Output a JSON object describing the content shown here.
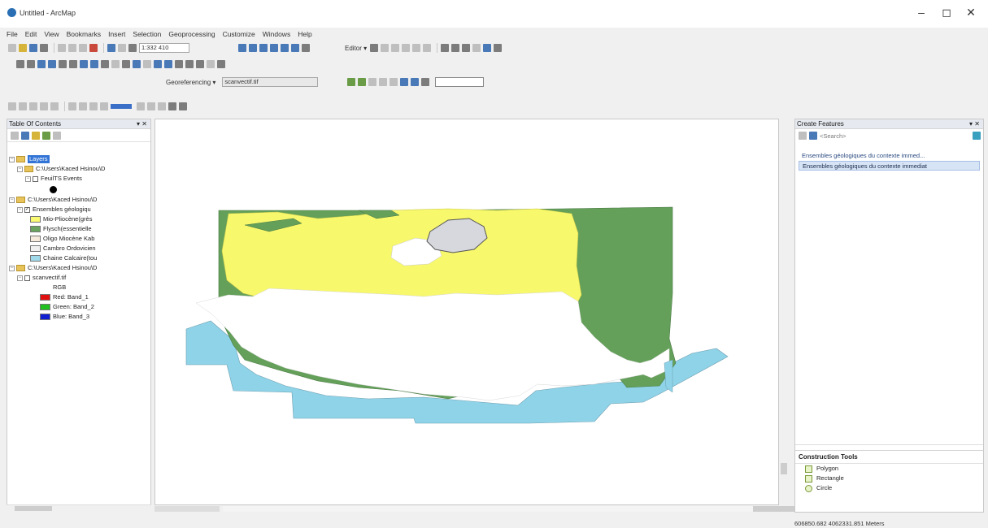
{
  "window": {
    "title": "Untitled - ArcMap",
    "controls": {
      "minimize": "–",
      "maximize": "◻",
      "close": "✕"
    }
  },
  "menu": [
    "File",
    "Edit",
    "View",
    "Bookmarks",
    "Insert",
    "Selection",
    "Geoprocessing",
    "Customize",
    "Windows",
    "Help"
  ],
  "toolbar": {
    "scale": "1:332 410",
    "editor": "Editor ▾",
    "georeferencing": "Georeferencing ▾",
    "georef_layer": "scanvectif.tif"
  },
  "toc": {
    "title": "Table Of Contents",
    "pin": "▾ ✕",
    "layers_label": "Layers",
    "group1_path": "C:\\Users\\Kaced Hsinou\\D",
    "feature_layer": "FeuilTS Events",
    "group2_path": "C:\\Users\\Kaced Hsinou\\D",
    "geo_layer": "Ensembles géologiqu",
    "legend": [
      {
        "label": "Mio-Pliocène(grès",
        "color": "#fafa73"
      },
      {
        "label": "Flysch(essentielle",
        "color": "#69a35f"
      },
      {
        "label": "Oligo Miocène Kab",
        "color": "#f6eadc"
      },
      {
        "label": "Cambro Ordovicien",
        "color": "#f0f0f0"
      },
      {
        "label": "Chaine Calcaire(tou",
        "color": "#9fd9ea"
      }
    ],
    "group3_path": "C:\\Users\\Kaced Hsinou\\D",
    "raster_layer": "scanvectif.tif",
    "rgb_label": "RGB",
    "bands": [
      {
        "label": "Red:   Band_1",
        "color": "#e01010"
      },
      {
        "label": "Green: Band_2",
        "color": "#20c020"
      },
      {
        "label": "Blue:  Band_3",
        "color": "#1020d0"
      }
    ]
  },
  "map": {
    "colors": {
      "mio_pliocene": "#f8f86c",
      "flysch": "#64a05a",
      "calcaire": "#8fd3e8",
      "cambro": "#d7d8de"
    }
  },
  "create_features": {
    "title": "Create Features",
    "pin": "▾ ✕",
    "search_placeholder": "<Search>",
    "template_group": "Ensembles géologiques du contexte immed...",
    "template_item": "Ensembles géologiques du contexte immediat",
    "construction_title": "Construction Tools",
    "tools": [
      "Polygon",
      "Rectangle",
      "Circle"
    ]
  },
  "status": {
    "coordinates": "606850.682  4062331.851 Meters"
  }
}
